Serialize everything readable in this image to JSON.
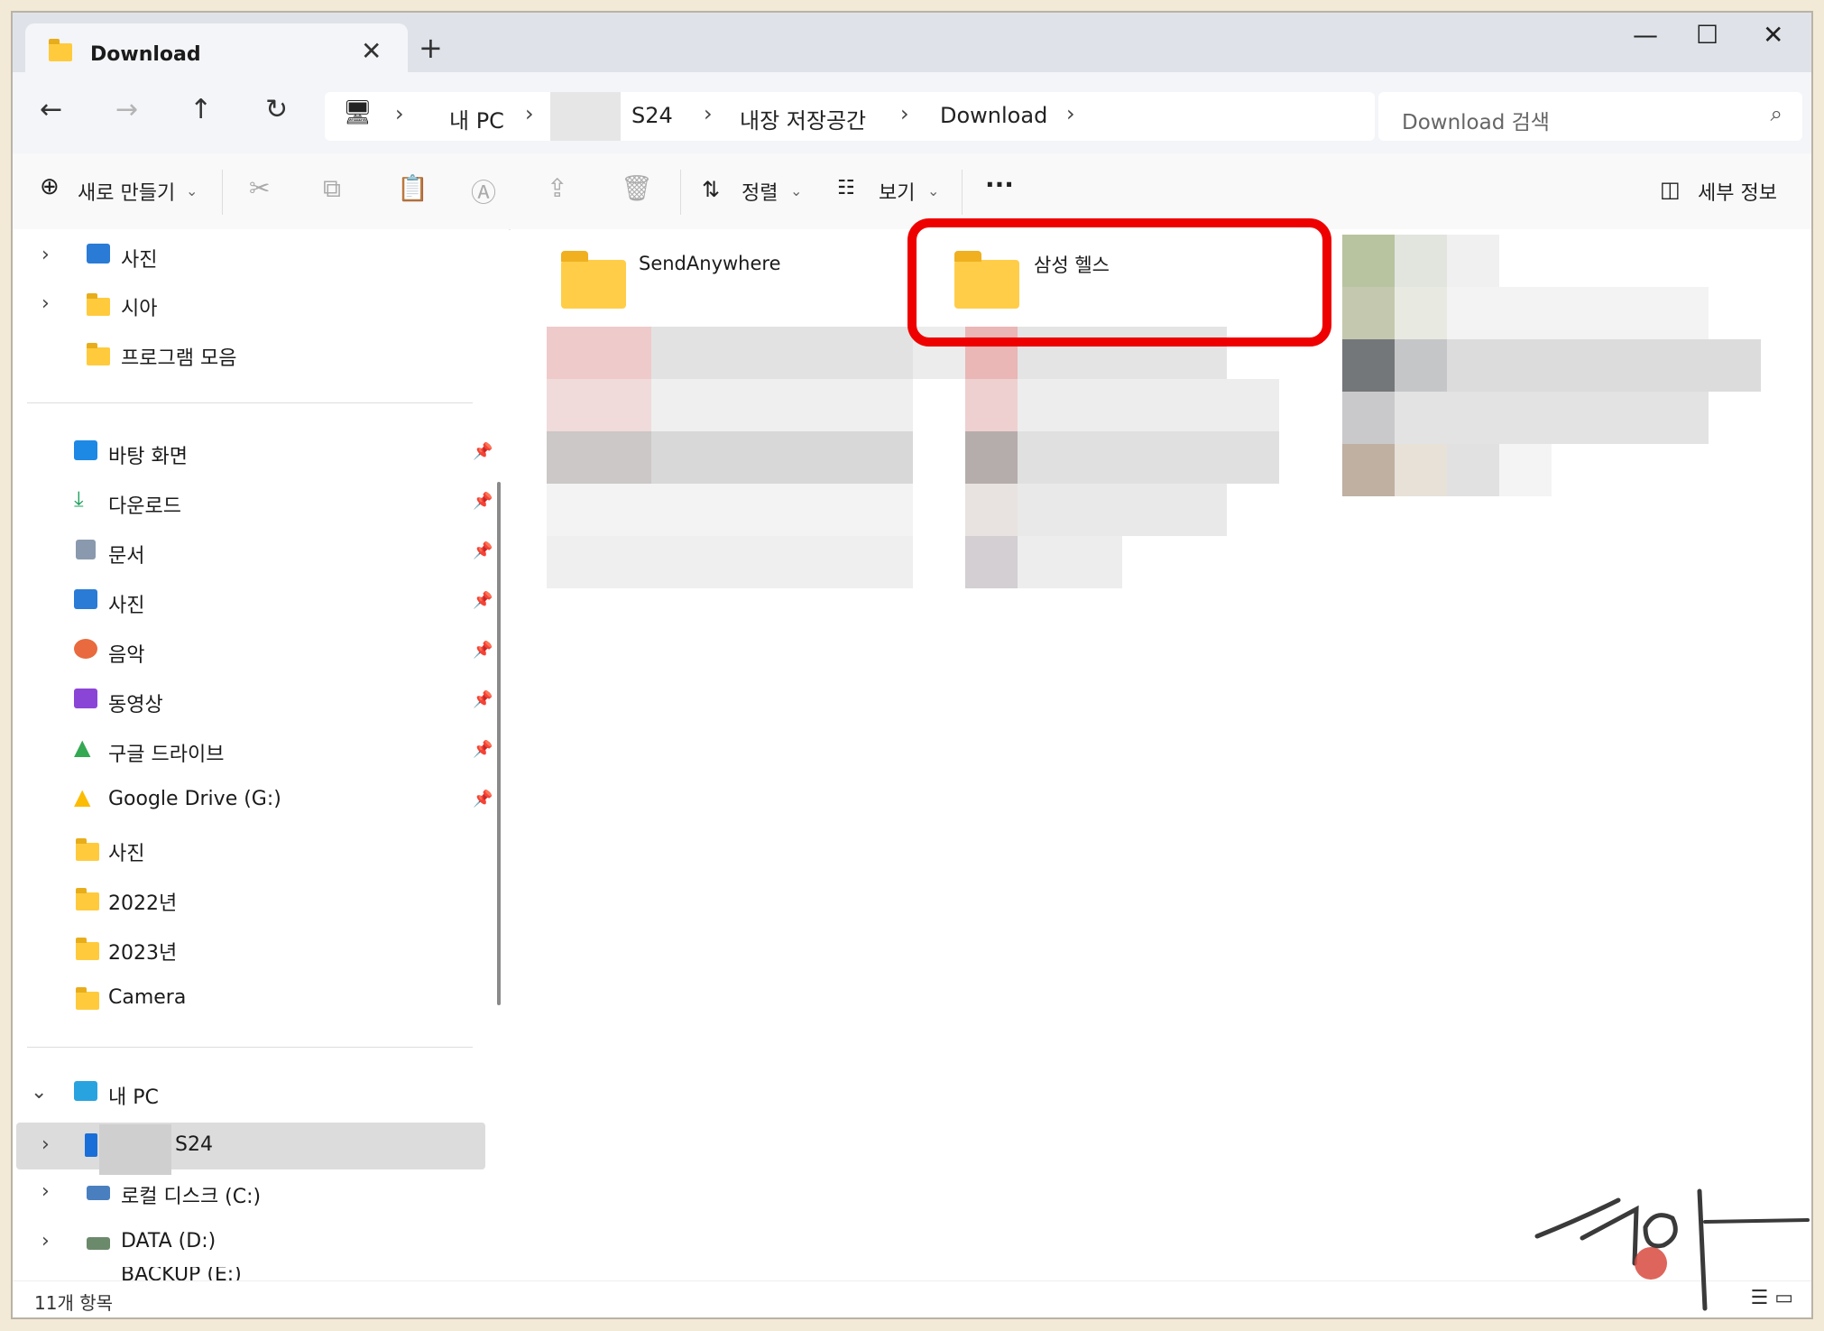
{
  "window": {
    "tab_title": "Download",
    "new_tab": "+",
    "minimize": "—",
    "maximize": "☐",
    "close": "✕"
  },
  "nav": {
    "back": "←",
    "forward": "→",
    "up": "↑",
    "refresh": "↻"
  },
  "address": {
    "crumbs": [
      "내 PC",
      "S24",
      "내장 저장공간",
      "Download"
    ],
    "search_placeholder": "Download 검색"
  },
  "toolbar": {
    "new_label": "새로 만들기",
    "sort_label": "정렬",
    "view_label": "보기",
    "more_label": "···",
    "details_label": "세부 정보"
  },
  "sidebar": {
    "top_items": [
      {
        "label": "사진",
        "icon": "photos-icon"
      },
      {
        "label": "시아",
        "icon": "folder-icon"
      },
      {
        "label": "프로그램 모음",
        "icon": "folder-icon"
      }
    ],
    "pinned": [
      {
        "label": "바탕 화면",
        "icon": "desktop-icon"
      },
      {
        "label": "다운로드",
        "icon": "download-icon"
      },
      {
        "label": "문서",
        "icon": "documents-icon"
      },
      {
        "label": "사진",
        "icon": "photos-icon"
      },
      {
        "label": "음악",
        "icon": "music-icon"
      },
      {
        "label": "동영상",
        "icon": "video-icon"
      },
      {
        "label": "구글 드라이브",
        "icon": "google-drive-icon"
      },
      {
        "label": "Google Drive (G:)",
        "icon": "google-drive-icon"
      }
    ],
    "folders": [
      {
        "label": "사진"
      },
      {
        "label": "2022년"
      },
      {
        "label": "2023년"
      },
      {
        "label": "Camera"
      }
    ],
    "this_pc": "내 PC",
    "drives": [
      {
        "label": "S24",
        "icon": "phone-icon"
      },
      {
        "label": "로컬 디스크 (C:)",
        "icon": "drive-icon"
      },
      {
        "label": "DATA (D:)",
        "icon": "drive-icon"
      },
      {
        "label": "BACKUP (E:)",
        "icon": "drive-icon"
      }
    ]
  },
  "content": {
    "folders": [
      {
        "name": "SendAnywhere"
      },
      {
        "name": "삼성 헬스"
      }
    ]
  },
  "status": {
    "count": "11개 항목"
  },
  "colors": {
    "highlight": "#ee0000",
    "folder": "#ffcd48"
  }
}
